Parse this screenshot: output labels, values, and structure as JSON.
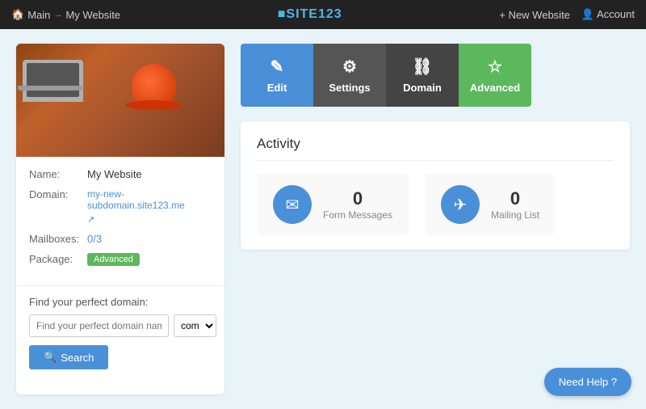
{
  "topNav": {
    "home": "Main",
    "separator": "→",
    "current": "My Website",
    "logo": "SITE123",
    "logo_icon": "■",
    "new_website": "+ New Website",
    "account": "Account"
  },
  "siteInfo": {
    "name_label": "Name:",
    "name_value": "My Website",
    "domain_label": "Domain:",
    "domain_value": "my-new-subdomain.site123.me",
    "mailboxes_label": "Mailboxes:",
    "mailboxes_value": "0/3",
    "package_label": "Package:",
    "package_value": "Advanced"
  },
  "domainSearch": {
    "label": "Find your perfect domain:",
    "placeholder": "Find your perfect domain name",
    "tld": "com",
    "button": "Search"
  },
  "actionButtons": [
    {
      "key": "edit",
      "label": "Edit",
      "icon": "✎"
    },
    {
      "key": "settings",
      "label": "Settings",
      "icon": "⚙"
    },
    {
      "key": "domain",
      "label": "Domain",
      "icon": "🔗"
    },
    {
      "key": "advanced",
      "label": "Advanced",
      "icon": "☆"
    }
  ],
  "activity": {
    "title": "Activity",
    "cards": [
      {
        "key": "form-messages",
        "icon": "✉",
        "count": "0",
        "label": "Form Messages"
      },
      {
        "key": "mailing-list",
        "icon": "✈",
        "count": "0",
        "label": "Mailing List"
      }
    ]
  },
  "help": {
    "label": "Need Help ?"
  }
}
